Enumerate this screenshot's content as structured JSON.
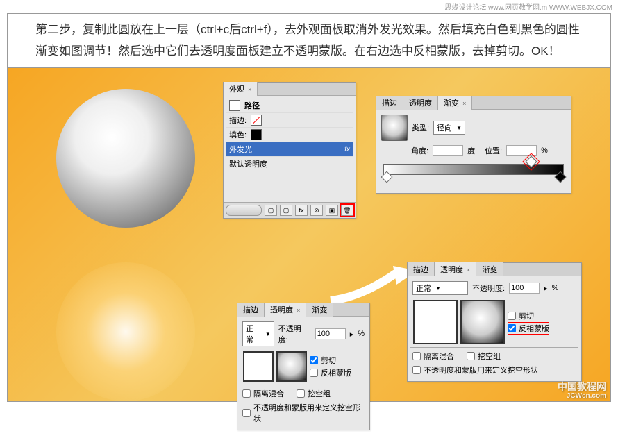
{
  "watermark_top": "思缘设计论坛 www.网页教学网.m WWW.WEBJX.COM",
  "instructions": "第二步，复制此圆放在上一层（ctrl+c后ctrl+f），去外观面板取消外发光效果。然后填充白色到黑色的圆性渐变如图调节！然后选中它们去透明度面板建立不透明蒙版。在右边选中反相蒙版，去掉剪切。OK！",
  "appearance": {
    "title": "外观",
    "path": "路径",
    "stroke": "描边:",
    "fill": "填色:",
    "outer_glow": "外发光",
    "default_trans": "默认透明度",
    "fx": "fx"
  },
  "gradient": {
    "tab_stroke": "描边",
    "tab_trans": "透明度",
    "tab_grad": "渐变",
    "type_label": "类型:",
    "type_value": "径向",
    "angle_label": "角度:",
    "angle_unit": "度",
    "pos_label": "位置:",
    "pos_unit": "%"
  },
  "transparency_small": {
    "tab_stroke": "描边",
    "tab_trans": "透明度",
    "tab_grad": "渐变",
    "mode": "正常",
    "opacity_label": "不透明度:",
    "opacity_value": "100",
    "clip": "剪切",
    "invert": "反相蒙版",
    "isolate": "隔离混合",
    "knockout": "挖空组",
    "longopt": "不透明度和蒙版用来定义挖空形状"
  },
  "transparency_large": {
    "tab_stroke": "描边",
    "tab_trans": "透明度",
    "tab_grad": "渐变",
    "mode": "正常",
    "opacity_label": "不透明度:",
    "opacity_value": "100",
    "pct": "%",
    "clip": "剪切",
    "invert": "反相蒙版",
    "isolate": "隔离混合",
    "knockout": "挖空组",
    "longopt": "不透明度和蒙版用来定义挖空形状"
  },
  "footer_wm_main": "中国教程网",
  "footer_wm_sub": "JCWcn.com"
}
